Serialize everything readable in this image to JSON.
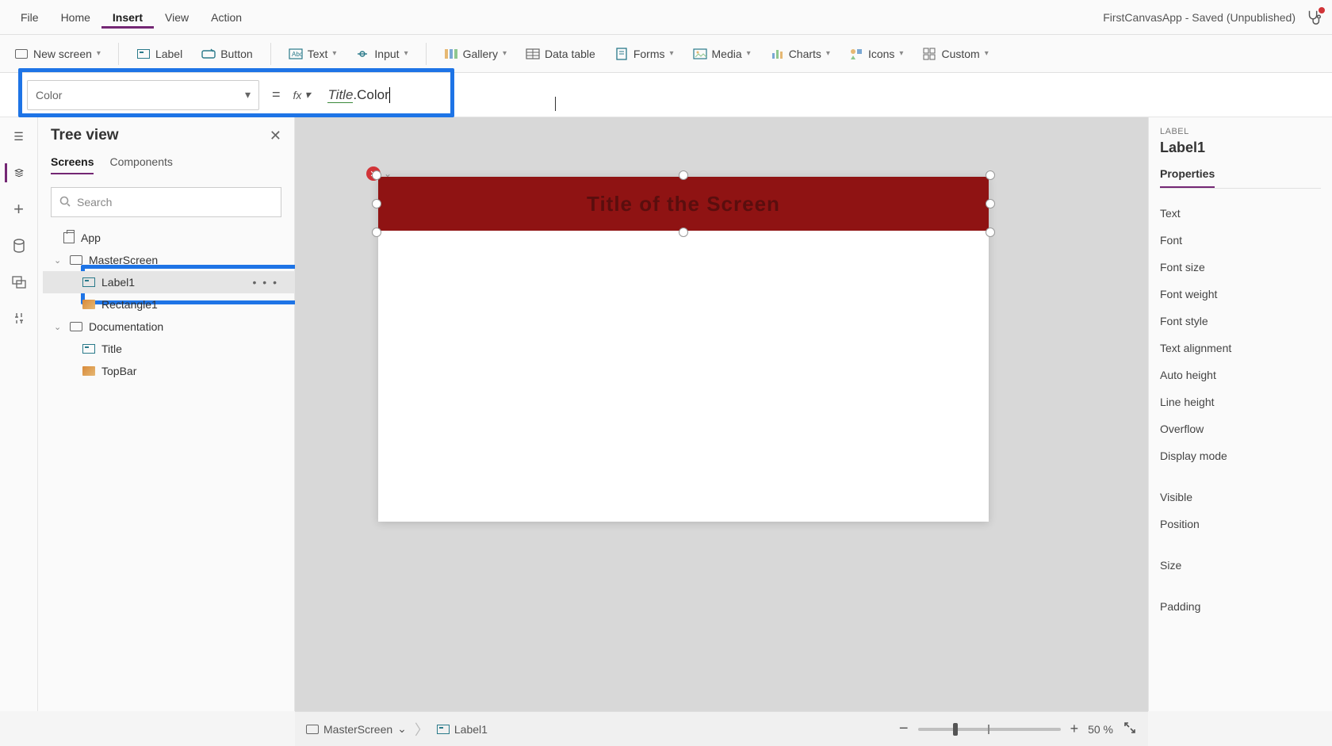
{
  "menu": {
    "items": [
      "File",
      "Home",
      "Insert",
      "View",
      "Action"
    ],
    "active": "Insert"
  },
  "app_title": "FirstCanvasApp - Saved (Unpublished)",
  "ribbon": {
    "new_screen": "New screen",
    "label": "Label",
    "button": "Button",
    "text": "Text",
    "input": "Input",
    "gallery": "Gallery",
    "data_table": "Data table",
    "forms": "Forms",
    "media": "Media",
    "charts": "Charts",
    "icons": "Icons",
    "custom": "Custom"
  },
  "formula": {
    "property": "Color",
    "fx": "fx",
    "ref": "Title",
    "prop": ".Color"
  },
  "tree": {
    "title": "Tree view",
    "tabs": {
      "screens": "Screens",
      "components": "Components",
      "active": "Screens"
    },
    "search_placeholder": "Search",
    "app": "App",
    "screens": [
      {
        "name": "MasterScreen",
        "children": [
          {
            "name": "Label1",
            "kind": "label",
            "selected": true
          },
          {
            "name": "Rectangle1",
            "kind": "rect"
          }
        ]
      },
      {
        "name": "Documentation",
        "children": [
          {
            "name": "Title",
            "kind": "label"
          },
          {
            "name": "TopBar",
            "kind": "rect"
          }
        ]
      }
    ]
  },
  "canvas": {
    "label_text": "Title of the Screen"
  },
  "props": {
    "kind": "LABEL",
    "name": "Label1",
    "tab": "Properties",
    "rows": [
      "Text",
      "Font",
      "Font size",
      "Font weight",
      "Font style",
      "Text alignment",
      "Auto height",
      "Line height",
      "Overflow",
      "Display mode",
      "",
      "Visible",
      "Position",
      "",
      "Size",
      "",
      "Padding"
    ]
  },
  "status": {
    "screen": "MasterScreen",
    "control": "Label1",
    "zoom": "50  %"
  }
}
